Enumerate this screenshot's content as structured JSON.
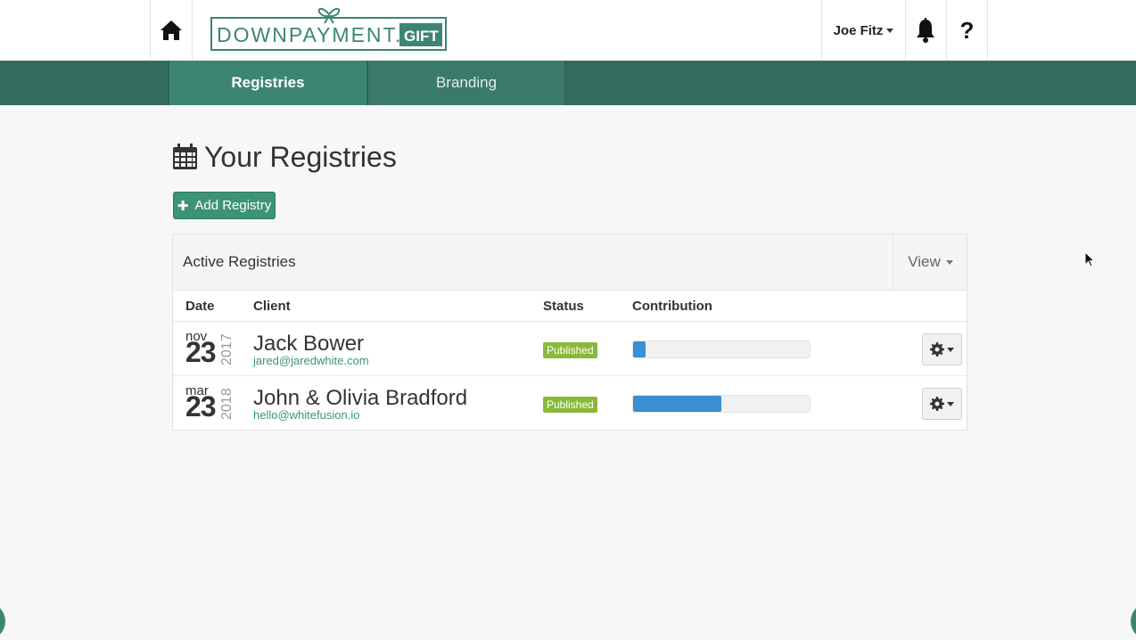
{
  "header": {
    "logo_text": "DOWNPAYMENT.",
    "logo_tag": "GIFT",
    "user_name": "Joe Fitz",
    "help_label": "?"
  },
  "nav": {
    "tabs": [
      {
        "label": "Registries",
        "active": true
      },
      {
        "label": "Branding",
        "active": false
      }
    ]
  },
  "page": {
    "title": "Your Registries",
    "add_button_label": "Add Registry"
  },
  "panel": {
    "title": "Active Registries",
    "view_label": "View",
    "columns": [
      "Date",
      "Client",
      "Status",
      "Contribution"
    ],
    "rows": [
      {
        "month": "nov",
        "day": "23",
        "year": "2017",
        "client_name": "Jack Bower",
        "client_email": "jared@jaredwhite.com",
        "status": "Published",
        "contribution_fraction": 0.07
      },
      {
        "month": "mar",
        "day": "23",
        "year": "2018",
        "client_name": "John & Olivia Bradford",
        "client_email": "hello@whitefusion.io",
        "status": "Published",
        "contribution_fraction": 0.5
      }
    ]
  },
  "colors": {
    "brand_green": "#336b5e",
    "active_tab": "#3d8573",
    "button_green": "#3d9377",
    "badge_green": "#8ab83a",
    "progress_blue": "#3b8fd0"
  },
  "icons": [
    "home-icon",
    "bell-icon",
    "calendar-icon",
    "plus-icon",
    "gear-icon",
    "caret-down-icon"
  ]
}
